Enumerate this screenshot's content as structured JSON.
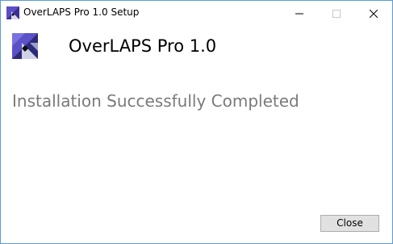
{
  "window": {
    "title": "OverLAPS Pro 1.0 Setup",
    "border_color": "#5a9bd8"
  },
  "titlebar": {
    "icon": "overlaps-app-icon",
    "minimize_icon": "minimize-icon",
    "maximize_icon": "maximize-icon",
    "close_icon": "close-icon"
  },
  "header": {
    "icon": "overlaps-logo-icon",
    "title": "OverLAPS Pro 1.0"
  },
  "main": {
    "status_text": "Installation Successfully Completed"
  },
  "footer": {
    "close_label": "Close"
  }
}
